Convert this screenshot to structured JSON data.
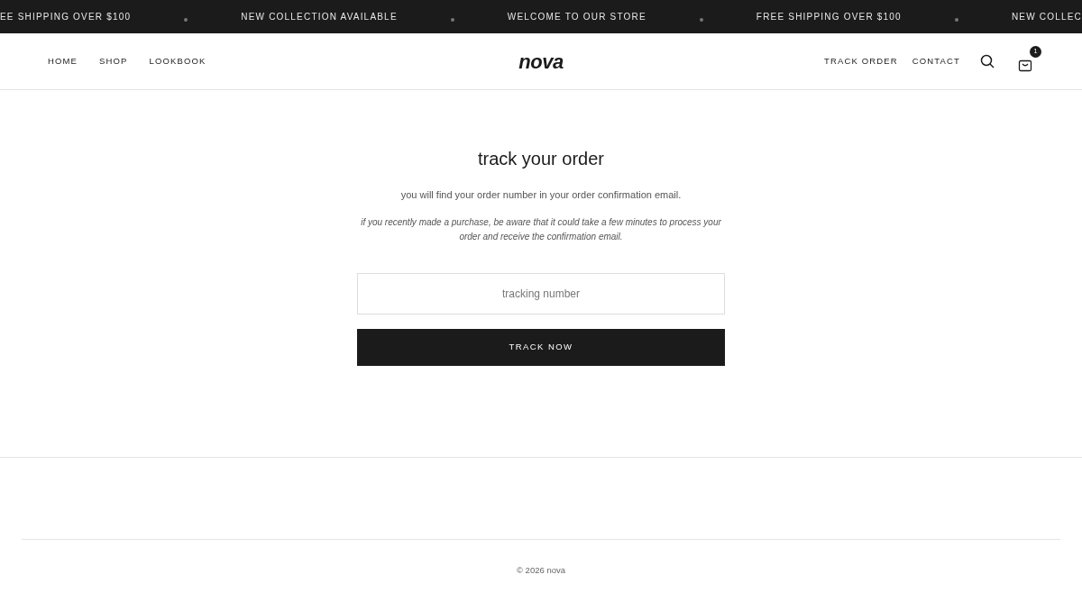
{
  "announcement_bar": [
    "EE SHIPPING OVER $100",
    "NEW COLLECTION AVAILABLE",
    "WELCOME TO OUR STORE",
    "FREE SHIPPING OVER $100",
    "NEW COLLEC"
  ],
  "header": {
    "nav_left": [
      "HOME",
      "SHOP",
      "LOOKBOOK"
    ],
    "logo": "nova",
    "nav_right": [
      "TRACK ORDER",
      "CONTACT"
    ],
    "cart_count": "1"
  },
  "main": {
    "title": "track your order",
    "subtitle": "you will find your order number in your order confirmation email.",
    "note": "if you recently made a purchase, be aware that it could take a few minutes to process your order and receive the confirmation email.",
    "field": {
      "placeholder": "tracking number"
    },
    "button": "TRACK NOW"
  },
  "footer": {
    "copyright": "© 2026 nova"
  }
}
